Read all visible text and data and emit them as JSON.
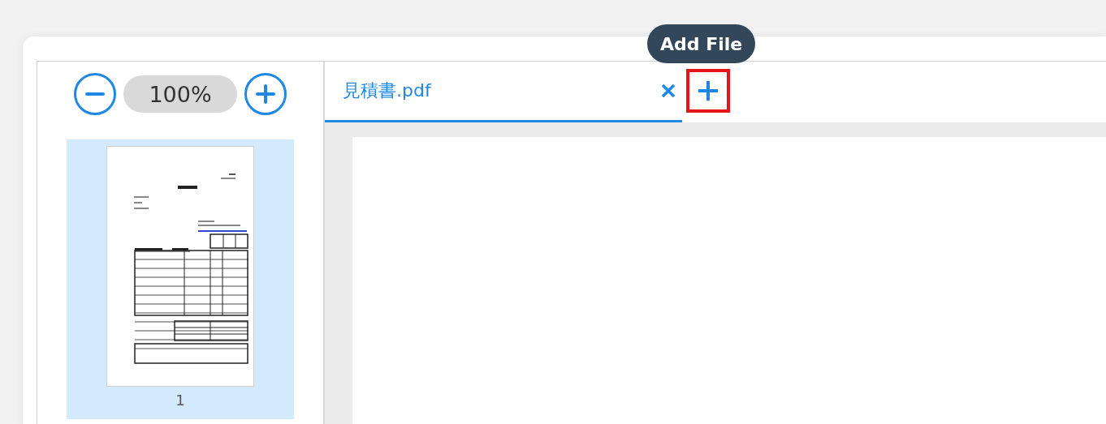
{
  "zoom": {
    "value": "100%"
  },
  "thumbnails": [
    {
      "page_label": "1",
      "selected": true
    }
  ],
  "tabs": [
    {
      "label": "見積書.pdf",
      "selected": true
    }
  ],
  "add_button": {
    "tooltip": "Add File",
    "highlighted": true
  }
}
